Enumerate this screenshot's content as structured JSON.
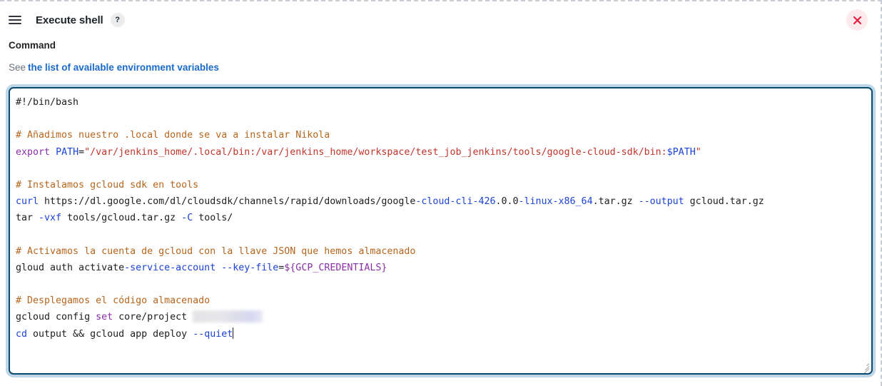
{
  "header": {
    "drag_handle_icon": "hamburger-drag-icon",
    "title": "Execute shell",
    "help_badge_label": "?",
    "close_icon": "close-x-icon",
    "close_color": "#e8193c",
    "close_bg": "#fdeaec"
  },
  "form": {
    "field_label": "Command",
    "help_prefix": "See",
    "help_link_text": "the list of available environment variables",
    "help_link_color": "#1a6aca"
  },
  "editor": {
    "border_color": "#0b4a6f",
    "focus_ring_color": "#bcd7e8",
    "resize_grip_icon": "resize-grip-icon",
    "caret_visible": true,
    "redacted_value": "",
    "colors": {
      "comment": "#b5651d",
      "keyword": "#8b2fa8",
      "variable": "#1b42d8",
      "flag": "#1b42d8",
      "string": "#c1342a",
      "plain": "#1c1e21"
    },
    "plain_text": "#!/bin/bash\n\n# Añadimos nuestro .local donde se va a instalar Nikola\nexport PATH=\"/var/jenkins_home/.local/bin:/var/jenkins_home/workspace/test_job_jenkins/tools/google-cloud-sdk/bin:$PATH\"\n\n# Instalamos gcloud sdk en tools\ncurl https://dl.google.com/dl/cloudsdk/channels/rapid/downloads/google-cloud-cli-426.0.0-linux-x86_64.tar.gz --output gcloud.tar.gz\ntar -vxf tools/gcloud.tar.gz -C tools/\n\n# Activamos la cuenta de gcloud con la llave JSON que hemos almacenado\ngloud auth activate-service-account --key-file=${GCP_CREDENTIALS}\n\n# Desplegamos el código almacenado\ngcloud config set core/project \ncd output && gcloud app deploy --quiet",
    "lines": [
      {
        "id": "l1",
        "tokens": [
          {
            "t": "plain",
            "v": "#!/bin/bash"
          }
        ]
      },
      {
        "id": "l2",
        "tokens": []
      },
      {
        "id": "l3",
        "tokens": [
          {
            "t": "comment",
            "v": "# Añadimos nuestro .local donde se va a instalar Nikola"
          }
        ]
      },
      {
        "id": "l4",
        "tokens": [
          {
            "t": "keyword",
            "v": "export"
          },
          {
            "t": "plain",
            "v": " "
          },
          {
            "t": "var",
            "v": "PATH"
          },
          {
            "t": "plain",
            "v": "="
          },
          {
            "t": "string",
            "v": "\"/var/jenkins_home/.local/bin:/var/jenkins_home/workspace/test_job_jenkins/tools/google-cloud-sdk/bin:"
          },
          {
            "t": "var",
            "v": "$PATH"
          },
          {
            "t": "string",
            "v": "\""
          }
        ]
      },
      {
        "id": "l5",
        "tokens": []
      },
      {
        "id": "l6",
        "tokens": [
          {
            "t": "comment",
            "v": "# Instalamos gcloud sdk en tools"
          }
        ]
      },
      {
        "id": "l7",
        "tokens": [
          {
            "t": "builtin",
            "v": "curl"
          },
          {
            "t": "plain",
            "v": " https://dl.google.com/dl/cloudsdk/channels/rapid/downloads/google"
          },
          {
            "t": "flag",
            "v": "-cloud-cli-426"
          },
          {
            "t": "plain",
            "v": ".0.0"
          },
          {
            "t": "flag",
            "v": "-linux-x86_64"
          },
          {
            "t": "plain",
            "v": ".tar.gz "
          },
          {
            "t": "flag",
            "v": "--output"
          },
          {
            "t": "plain",
            "v": " gcloud.tar.gz"
          }
        ]
      },
      {
        "id": "l8",
        "tokens": [
          {
            "t": "plain",
            "v": "tar "
          },
          {
            "t": "flag",
            "v": "-vxf"
          },
          {
            "t": "plain",
            "v": " tools/gcloud.tar.gz "
          },
          {
            "t": "flag",
            "v": "-C"
          },
          {
            "t": "plain",
            "v": " tools/"
          }
        ]
      },
      {
        "id": "l9",
        "tokens": []
      },
      {
        "id": "l10",
        "tokens": [
          {
            "t": "comment",
            "v": "# Activamos la cuenta de gcloud con la llave JSON que hemos almacenado"
          }
        ]
      },
      {
        "id": "l11",
        "tokens": [
          {
            "t": "plain",
            "v": "gloud auth activate"
          },
          {
            "t": "flag",
            "v": "-service-account"
          },
          {
            "t": "plain",
            "v": " "
          },
          {
            "t": "flag",
            "v": "--key-file"
          },
          {
            "t": "plain",
            "v": "="
          },
          {
            "t": "keyword",
            "v": "${GCP_CREDENTIALS}"
          }
        ]
      },
      {
        "id": "l12",
        "tokens": []
      },
      {
        "id": "l13",
        "tokens": [
          {
            "t": "comment",
            "v": "# Desplegamos el código almacenado"
          }
        ]
      },
      {
        "id": "l14",
        "tokens": [
          {
            "t": "plain",
            "v": "gcloud config "
          },
          {
            "t": "keyword",
            "v": "set"
          },
          {
            "t": "plain",
            "v": " core/project "
          },
          {
            "t": "redacted",
            "v": ""
          }
        ]
      },
      {
        "id": "l15",
        "tokens": [
          {
            "t": "builtin",
            "v": "cd"
          },
          {
            "t": "plain",
            "v": " output && gcloud app deploy "
          },
          {
            "t": "flag",
            "v": "--quiet"
          },
          {
            "t": "caret",
            "v": ""
          }
        ]
      }
    ]
  }
}
